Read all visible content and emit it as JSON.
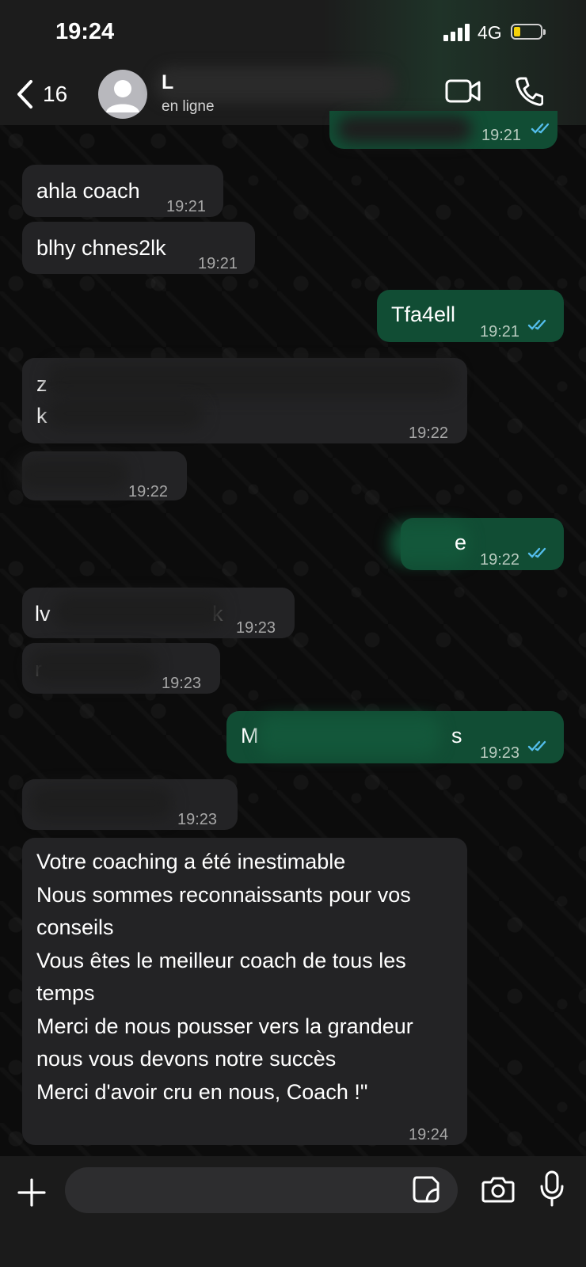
{
  "status_bar": {
    "time": "19:24",
    "network": "4G",
    "battery_level": 0.25
  },
  "header": {
    "back_count": "16",
    "contact_name": "L",
    "contact_status": "en ligne"
  },
  "messages": [
    {
      "dir": "out",
      "text": "",
      "time": "19:21",
      "read": true
    },
    {
      "dir": "in",
      "text": "ahla coach",
      "time": "19:21"
    },
    {
      "dir": "in",
      "text": "blhy chnes2lk",
      "time": "19:21"
    },
    {
      "dir": "out",
      "text": "Tfa4ell",
      "time": "19:21",
      "read": true
    },
    {
      "dir": "in",
      "text": "z",
      "text2": "k",
      "time": "19:22"
    },
    {
      "dir": "in",
      "text": "",
      "time": "19:22"
    },
    {
      "dir": "out",
      "text": "e",
      "time": "19:22",
      "read": true
    },
    {
      "dir": "in",
      "text": "lv",
      "text_end": "k",
      "time": "19:23"
    },
    {
      "dir": "in",
      "text": "r",
      "time": "19:23"
    },
    {
      "dir": "out",
      "text": "M",
      "text_end": "s",
      "time": "19:23",
      "read": true
    },
    {
      "dir": "in",
      "text": "",
      "time": "19:23"
    },
    {
      "dir": "in",
      "lines": [
        "Votre coaching a été inestimable",
        "Nous sommes reconnaissants pour vos",
        "conseils",
        "Vous êtes le meilleur coach de tous les",
        "temps",
        "Merci de nous pousser vers la grandeur",
        "nous vous devons notre succès",
        "Merci d'avoir cru en nous, Coach !\""
      ],
      "time": "19:24"
    }
  ],
  "colors": {
    "incoming_bubble": "#232325",
    "outgoing_bubble": "#114d34",
    "read_ticks": "#53bdeb"
  }
}
